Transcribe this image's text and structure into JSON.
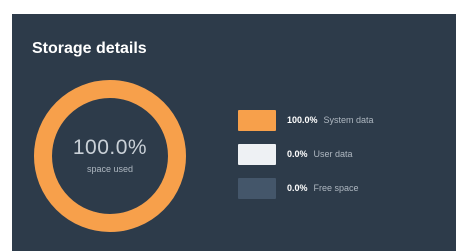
{
  "panel": {
    "title": "Storage details"
  },
  "usage": {
    "percent_used": 100.0,
    "center_value": "100.0%",
    "center_label": "space used"
  },
  "legend": [
    {
      "value": "100.0%",
      "label": "System data",
      "color": "#f7a04b",
      "fraction": 1.0
    },
    {
      "value": "0.0%",
      "label": "User data",
      "color": "#eef1f4",
      "fraction": 0.0
    },
    {
      "value": "0.0%",
      "label": "Free space",
      "color": "#44566a",
      "fraction": 0.0
    }
  ],
  "colors": {
    "panel_background": "#2d3b4a",
    "ring_track": "#44566a",
    "ring_used": "#f7a04b"
  }
}
